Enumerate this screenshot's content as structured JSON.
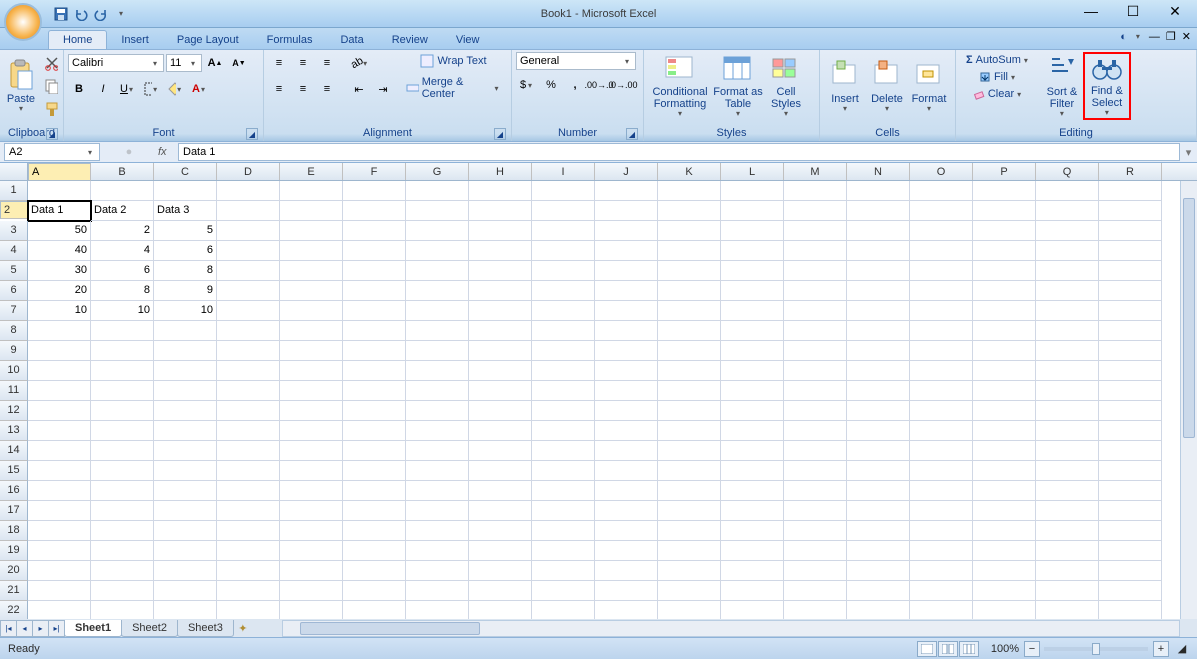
{
  "title": "Book1 - Microsoft Excel",
  "tabs": [
    "Home",
    "Insert",
    "Page Layout",
    "Formulas",
    "Data",
    "Review",
    "View"
  ],
  "activeTab": 0,
  "ribbon": {
    "clipboard": {
      "paste": "Paste",
      "label": "Clipboard"
    },
    "font": {
      "family": "Calibri",
      "size": "11",
      "label": "Font"
    },
    "alignment": {
      "wrap": "Wrap Text",
      "merge": "Merge & Center",
      "label": "Alignment"
    },
    "number": {
      "format": "General",
      "label": "Number"
    },
    "styles": {
      "cf": "Conditional Formatting",
      "table": "Format as Table",
      "cell": "Cell Styles",
      "label": "Styles"
    },
    "cells": {
      "insert": "Insert",
      "delete": "Delete",
      "format": "Format",
      "label": "Cells"
    },
    "editing": {
      "sum": "AutoSum",
      "fill": "Fill",
      "clear": "Clear",
      "sort": "Sort & Filter",
      "find": "Find & Select",
      "label": "Editing"
    }
  },
  "namebox": "A2",
  "formula": "Data 1",
  "columns": [
    "A",
    "B",
    "C",
    "D",
    "E",
    "F",
    "G",
    "H",
    "I",
    "J",
    "K",
    "L",
    "M",
    "N",
    "O",
    "P",
    "Q",
    "R"
  ],
  "rows": 22,
  "activeCell": {
    "r": 2,
    "c": 0
  },
  "cells": {
    "2": {
      "0": "Data 1",
      "1": "Data 2",
      "2": "Data 3"
    },
    "3": {
      "0": 50,
      "1": 2,
      "2": 5
    },
    "4": {
      "0": 40,
      "1": 4,
      "2": 6
    },
    "5": {
      "0": 30,
      "1": 6,
      "2": 8
    },
    "6": {
      "0": 20,
      "1": 8,
      "2": 9
    },
    "7": {
      "0": 10,
      "1": 10,
      "2": 10
    }
  },
  "sheets": [
    "Sheet1",
    "Sheet2",
    "Sheet3"
  ],
  "activeSheet": 0,
  "status": "Ready",
  "zoom": "100%"
}
